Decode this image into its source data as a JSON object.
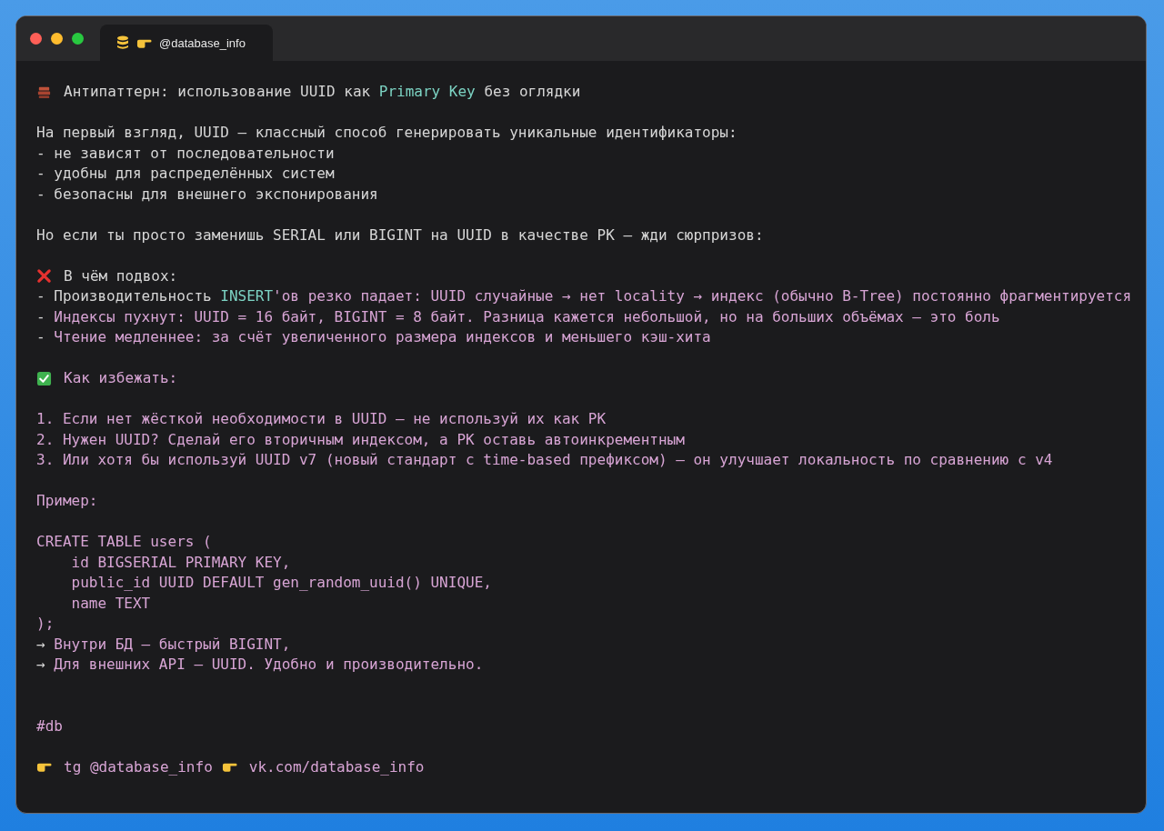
{
  "window": {
    "tab": {
      "title": "@database_info",
      "selected": true
    }
  },
  "blocks": [
    {
      "lines": [
        [
          {
            "kind": "brick"
          },
          {
            "kind": "plain",
            "text": "Антипаттерн: использование UUID как "
          },
          {
            "kind": "keyword",
            "text": "Primary Key"
          },
          {
            "kind": "plain",
            "text": " без оглядки"
          }
        ]
      ]
    },
    {
      "lines": [
        [
          {
            "kind": "plain",
            "text": "На первый взгляд, UUID — классный способ генерировать уникальные идентификаторы:"
          }
        ],
        [
          {
            "kind": "plain",
            "text": "- не зависят от последовательности"
          }
        ],
        [
          {
            "kind": "plain",
            "text": "- удобны для распределённых систем"
          }
        ],
        [
          {
            "kind": "plain",
            "text": "- безопасны для внешнего экспонирования"
          }
        ]
      ]
    },
    {
      "lines": [
        [
          {
            "kind": "plain",
            "text": "Но если ты просто заменишь SERIAL или BIGINT на UUID в качестве PK — жди сюрпризов:"
          }
        ]
      ]
    },
    {
      "lines": [
        [
          {
            "kind": "cross"
          },
          {
            "kind": "plain",
            "text": "В чём подвох:"
          }
        ],
        [
          {
            "kind": "plain",
            "text": "- Производительность "
          },
          {
            "kind": "keyword",
            "text": "INSERT"
          },
          {
            "kind": "accent",
            "text": "'ов резко падает: UUID случайные → нет locality → индекс (обычно B-Tree) постоянно фрагментируется"
          }
        ],
        [
          {
            "kind": "plain",
            "text": "- "
          },
          {
            "kind": "accent",
            "text": "Индексы пухнут: UUID = 16 байт, BIGINT = 8 байт. Разница кажется небольшой, но на больших объёмах — это боль"
          }
        ],
        [
          {
            "kind": "plain",
            "text": "- "
          },
          {
            "kind": "accent",
            "text": "Чтение медленнее: за счёт увеличенного размера индексов и меньшего кэш-хита"
          }
        ]
      ]
    },
    {
      "lines": [
        [
          {
            "kind": "check"
          },
          {
            "kind": "accent",
            "text": "Как избежать:"
          }
        ]
      ]
    },
    {
      "lines": [
        [
          {
            "kind": "accent",
            "text": "1. Если нет жёсткой необходимости в UUID — не используй их как PK"
          }
        ],
        [
          {
            "kind": "accent",
            "text": "2. Нужен UUID? Сделай его вторичным индексом, а PK оставь автоинкрементным"
          }
        ],
        [
          {
            "kind": "accent",
            "text": "3. Или хотя бы используй UUID v7 (новый стандарт с time-based префиксом) — он улучшает локальность по сравнению с v4"
          }
        ]
      ]
    },
    {
      "lines": [
        [
          {
            "kind": "accent",
            "text": "Пример:"
          }
        ]
      ]
    },
    {
      "lines": [
        [
          {
            "kind": "accent",
            "text": "CREATE TABLE users ("
          }
        ],
        [
          {
            "kind": "accent",
            "text": "    id BIGSERIAL PRIMARY KEY,"
          }
        ],
        [
          {
            "kind": "accent",
            "text": "    public_id UUID DEFAULT gen_random_uuid() UNIQUE,"
          }
        ],
        [
          {
            "kind": "accent",
            "text": "    name TEXT"
          }
        ],
        [
          {
            "kind": "accent",
            "text": ");"
          }
        ],
        [
          {
            "kind": "plain",
            "text": "→ "
          },
          {
            "kind": "accent",
            "text": "Внутри БД — быстрый BIGINT,"
          }
        ],
        [
          {
            "kind": "plain",
            "text": "→ "
          },
          {
            "kind": "accent",
            "text": "Для внешних API — UUID. Удобно и производительно."
          }
        ]
      ]
    },
    {
      "kind": "tags",
      "lines": [
        [
          {
            "kind": "accent",
            "text": "#db"
          }
        ]
      ]
    },
    {
      "lines": [
        [
          {
            "kind": "pointer"
          },
          {
            "kind": "accent",
            "text": "tg @database_info"
          },
          {
            "kind": "pointer"
          },
          {
            "kind": "accent",
            "text": "vk.com/database_info"
          }
        ]
      ]
    }
  ]
}
